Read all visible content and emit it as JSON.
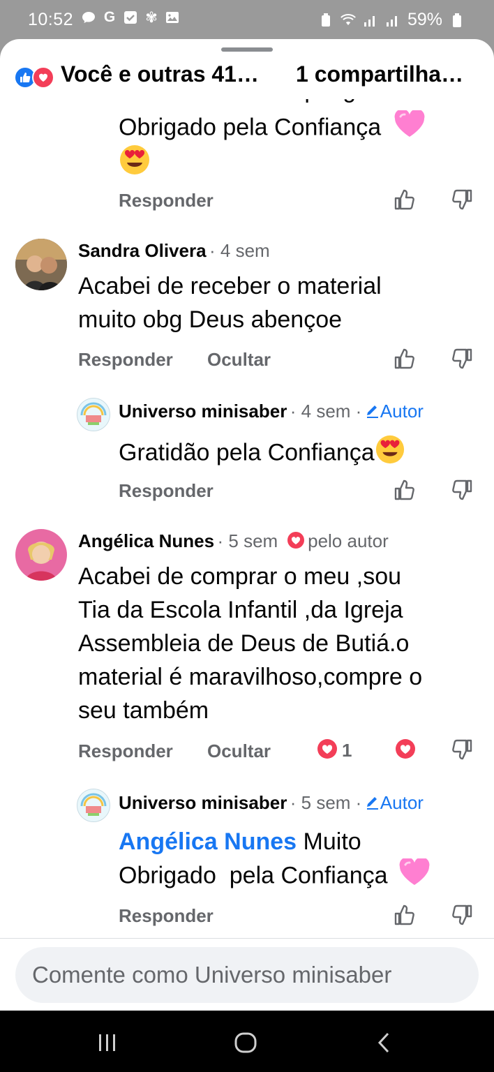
{
  "status_bar": {
    "time": "10:52",
    "battery": "59%",
    "left_icons": [
      "message-icon",
      "google-icon",
      "check-box-icon",
      "flower-icon",
      "gallery-icon"
    ],
    "right_icons": [
      "battery-saver-icon",
      "wifi-icon",
      "signal-icon",
      "signal-icon",
      "battery-icon"
    ]
  },
  "reaction_bar": {
    "reactions_text": "Você e outras 41…",
    "shares_text": "1 compartilha…"
  },
  "partial_comment": {
    "cut_line": "Ficamos Felizes que gostou",
    "text": "Obrigado pela Confiança",
    "emojis": [
      "pink-heart-icon",
      "heart-eyes-icon"
    ],
    "reply_label": "Responder"
  },
  "comments": [
    {
      "author": "Sandra Olivera",
      "time": "· 4 sem",
      "text_line1": "Acabei de receber o material",
      "text_line2": "muito obg Deus abençoe",
      "reply_label": "Responder",
      "hide_label": "Ocultar",
      "reply": {
        "author": "Universo minisaber",
        "time": "· 4 sem ·",
        "badge": "Autor",
        "text": "Gratidão pela Confiança",
        "reply_label": "Responder"
      }
    },
    {
      "author": "Angélica Nunes",
      "time": "· 5 sem",
      "loved_by": "pelo autor",
      "text_lines": [
        "Acabei de comprar o meu ,sou",
        "Tia da Escola Infantil ,da Igreja",
        "Assembleia de Deus de Butiá.o",
        "material é maravilhoso,compre o",
        "seu também"
      ],
      "reply_label": "Responder",
      "hide_label": "Ocultar",
      "reaction_count": "1",
      "reply": {
        "author": "Universo minisaber",
        "time": "· 5 sem ·",
        "badge": "Autor",
        "mention": "Angélica Nunes",
        "text_line1": "Muito",
        "text_line2": "Obrigado  pela Confiança",
        "reply_label": "Responder"
      }
    }
  ],
  "comment_box": {
    "placeholder": "Comente como Universo minisaber"
  },
  "colors": {
    "accent": "#1877f2",
    "love": "#f33e58",
    "meta": "#65676b"
  }
}
